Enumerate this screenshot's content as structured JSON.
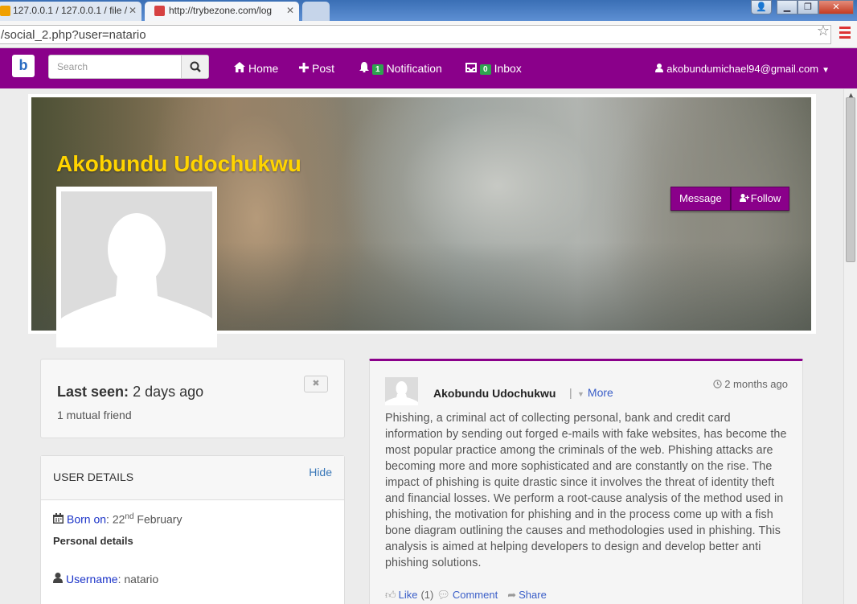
{
  "browser": {
    "tabs": [
      {
        "label": "127.0.0.1 / 127.0.0.1 / file /"
      },
      {
        "label": "http://trybezone.com/log"
      },
      {
        "label": ""
      }
    ],
    "url": "/social_2.php?user=natario"
  },
  "navbar": {
    "brand": "b",
    "search_placeholder": "Search",
    "home": "Home",
    "post": "Post",
    "notification": "Notification",
    "notification_count": "1",
    "inbox": "Inbox",
    "inbox_count": "0",
    "user_email": "akobundumichael94@gmail.com"
  },
  "profile": {
    "name": "Akobundu Udochukwu",
    "message_button": "Message",
    "follow_button": "Follow"
  },
  "status": {
    "last_seen_label": "Last seen:",
    "last_seen_value": "2 days ago",
    "mutual": "1 mutual friend"
  },
  "user_details": {
    "title": "USER DETAILS",
    "hide": "Hide",
    "born_label": "Born on",
    "born_day": "22",
    "born_suffix": "nd",
    "born_month": "February",
    "personal_heading": "Personal details",
    "username_label": "Username",
    "username_value": "natario"
  },
  "post": {
    "author": "Akobundu Udochukwu",
    "separator": "|",
    "more": "More",
    "time": "2 months ago",
    "text": "Phishing, a criminal act of collecting personal, bank and credit card information by sending out forged e-mails with fake websites, has become the most popular practice among the criminals of the web. Phishing attacks are becoming more and more sophisticated and are constantly on the rise. The impact of phishing is quite drastic since it involves the threat of identity theft and financial losses. We perform a root-cause analysis of the method used in phishing, the motivation for phishing and in the process come up with a fish bone diagram outlining the causes and methodologies used in phishing. This analysis is aimed at helping developers to design and develop better anti phishing solutions.",
    "like": "Like",
    "like_count": "(1)",
    "comment": "Comment",
    "share": "Share"
  },
  "colors": {
    "brand_purple": "#8a008a",
    "name_yellow": "#ffd400",
    "link_blue": "#3a5ec8"
  }
}
